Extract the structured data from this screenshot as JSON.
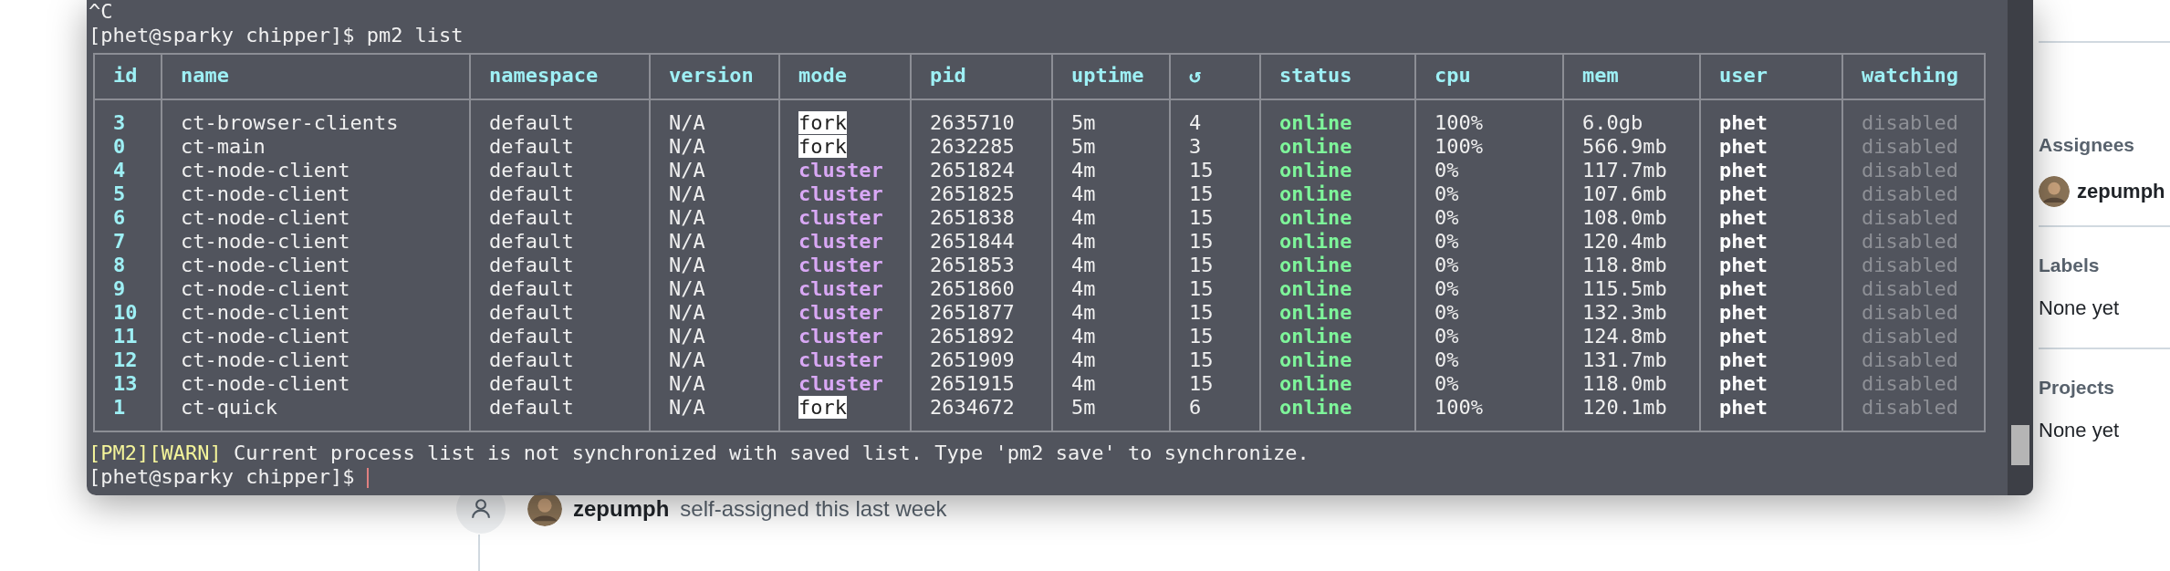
{
  "terminal": {
    "lines_before": [
      "^C",
      "[phet@sparky chipper]$ pm2 list"
    ],
    "table": {
      "columns": [
        "id",
        "name",
        "namespace",
        "version",
        "mode",
        "pid",
        "uptime",
        "↺",
        "status",
        "cpu",
        "mem",
        "user",
        "watching"
      ],
      "rows": [
        {
          "id": "3",
          "name": "ct-browser-clients",
          "namespace": "default",
          "version": "N/A",
          "mode": "fork",
          "highlighted": true,
          "pid": "2635710",
          "uptime": "5m",
          "restarts": "4",
          "status": "online",
          "cpu": "100%",
          "mem": "6.0gb",
          "user": "phet",
          "watching": "disabled"
        },
        {
          "id": "0",
          "name": "ct-main",
          "namespace": "default",
          "version": "N/A",
          "mode": "fork",
          "highlighted": true,
          "pid": "2632285",
          "uptime": "5m",
          "restarts": "3",
          "status": "online",
          "cpu": "100%",
          "mem": "566.9mb",
          "user": "phet",
          "watching": "disabled"
        },
        {
          "id": "4",
          "name": "ct-node-client",
          "namespace": "default",
          "version": "N/A",
          "mode": "cluster",
          "highlighted": false,
          "pid": "2651824",
          "uptime": "4m",
          "restarts": "15",
          "status": "online",
          "cpu": "0%",
          "mem": "117.7mb",
          "user": "phet",
          "watching": "disabled"
        },
        {
          "id": "5",
          "name": "ct-node-client",
          "namespace": "default",
          "version": "N/A",
          "mode": "cluster",
          "highlighted": false,
          "pid": "2651825",
          "uptime": "4m",
          "restarts": "15",
          "status": "online",
          "cpu": "0%",
          "mem": "107.6mb",
          "user": "phet",
          "watching": "disabled"
        },
        {
          "id": "6",
          "name": "ct-node-client",
          "namespace": "default",
          "version": "N/A",
          "mode": "cluster",
          "highlighted": false,
          "pid": "2651838",
          "uptime": "4m",
          "restarts": "15",
          "status": "online",
          "cpu": "0%",
          "mem": "108.0mb",
          "user": "phet",
          "watching": "disabled"
        },
        {
          "id": "7",
          "name": "ct-node-client",
          "namespace": "default",
          "version": "N/A",
          "mode": "cluster",
          "highlighted": false,
          "pid": "2651844",
          "uptime": "4m",
          "restarts": "15",
          "status": "online",
          "cpu": "0%",
          "mem": "120.4mb",
          "user": "phet",
          "watching": "disabled"
        },
        {
          "id": "8",
          "name": "ct-node-client",
          "namespace": "default",
          "version": "N/A",
          "mode": "cluster",
          "highlighted": false,
          "pid": "2651853",
          "uptime": "4m",
          "restarts": "15",
          "status": "online",
          "cpu": "0%",
          "mem": "118.8mb",
          "user": "phet",
          "watching": "disabled"
        },
        {
          "id": "9",
          "name": "ct-node-client",
          "namespace": "default",
          "version": "N/A",
          "mode": "cluster",
          "highlighted": false,
          "pid": "2651860",
          "uptime": "4m",
          "restarts": "15",
          "status": "online",
          "cpu": "0%",
          "mem": "115.5mb",
          "user": "phet",
          "watching": "disabled"
        },
        {
          "id": "10",
          "name": "ct-node-client",
          "namespace": "default",
          "version": "N/A",
          "mode": "cluster",
          "highlighted": false,
          "pid": "2651877",
          "uptime": "4m",
          "restarts": "15",
          "status": "online",
          "cpu": "0%",
          "mem": "132.3mb",
          "user": "phet",
          "watching": "disabled"
        },
        {
          "id": "11",
          "name": "ct-node-client",
          "namespace": "default",
          "version": "N/A",
          "mode": "cluster",
          "highlighted": false,
          "pid": "2651892",
          "uptime": "4m",
          "restarts": "15",
          "status": "online",
          "cpu": "0%",
          "mem": "124.8mb",
          "user": "phet",
          "watching": "disabled"
        },
        {
          "id": "12",
          "name": "ct-node-client",
          "namespace": "default",
          "version": "N/A",
          "mode": "cluster",
          "highlighted": false,
          "pid": "2651909",
          "uptime": "4m",
          "restarts": "15",
          "status": "online",
          "cpu": "0%",
          "mem": "131.7mb",
          "user": "phet",
          "watching": "disabled"
        },
        {
          "id": "13",
          "name": "ct-node-client",
          "namespace": "default",
          "version": "N/A",
          "mode": "cluster",
          "highlighted": false,
          "pid": "2651915",
          "uptime": "4m",
          "restarts": "15",
          "status": "online",
          "cpu": "0%",
          "mem": "118.0mb",
          "user": "phet",
          "watching": "disabled"
        },
        {
          "id": "1",
          "name": "ct-quick",
          "namespace": "default",
          "version": "N/A",
          "mode": "fork",
          "highlighted": true,
          "pid": "2634672",
          "uptime": "5m",
          "restarts": "6",
          "status": "online",
          "cpu": "100%",
          "mem": "120.1mb",
          "user": "phet",
          "watching": "disabled"
        }
      ]
    },
    "warning": {
      "tags": [
        "[PM2]",
        "[WARN]"
      ],
      "message": " Current process list is not synchronized with saved list. Type 'pm2 save' to synchronize."
    },
    "prompt": "[phet@sparky chipper]$"
  },
  "timeline_event": {
    "user": "zepumph",
    "text": "self-assigned this last week"
  },
  "sidebar": [
    {
      "heading": "Assignees",
      "assignee": "zepumph"
    },
    {
      "heading": "Labels",
      "value": "None yet"
    },
    {
      "heading": "Projects",
      "value": "None yet"
    }
  ]
}
